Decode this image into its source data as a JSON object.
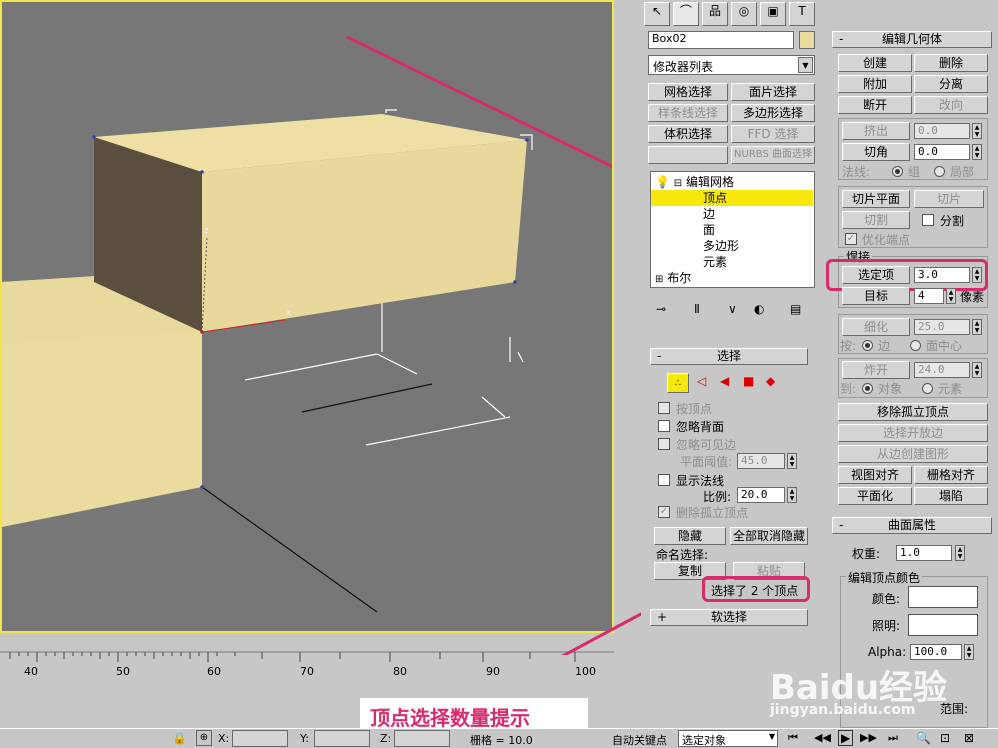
{
  "viewport": {
    "axis_x": "x",
    "axis_z": "z"
  },
  "ruler": {
    "ticks": [
      "40",
      "50",
      "60",
      "70",
      "80",
      "90",
      "100"
    ]
  },
  "caption": "顶点选择数量提示",
  "status": {
    "x_label": "X:",
    "y_label": "Y:",
    "z_label": "Z:",
    "grid": "栅格 = 10.0",
    "autokey": "自动关键点",
    "selection": "选定对象"
  },
  "modify_panel": {
    "object_name": "Box02",
    "modifier_list": "修改器列表",
    "buttons": [
      "网格选择",
      "面片选择",
      "样条线选择",
      "多边形选择",
      "体积选择",
      "FFD 选择",
      "NURBS 曲面选择"
    ],
    "stack": {
      "root": "编辑网格",
      "items": [
        "顶点",
        "边",
        "面",
        "多边形",
        "元素"
      ],
      "selected": "顶点",
      "bottom": "布尔"
    }
  },
  "selection": {
    "title": "选择",
    "by_vertex": "按顶点",
    "ignore_backfacing": "忽略背面",
    "ignore_visible_edges": "忽略可见边",
    "planar_thresh_label": "平面阈值:",
    "planar_thresh_value": "45.0",
    "show_normals": "显示法线",
    "scale_label": "比例:",
    "scale_value": "20.0",
    "delete_isolated": "删除孤立顶点",
    "hide": "隐藏",
    "unhide_all": "全部取消隐藏",
    "named_sel": "命名选择:",
    "copy": "复制",
    "paste": "粘贴",
    "info": "选择了 2 个顶点",
    "soft_selection": "软选择"
  },
  "edit_geometry": {
    "title": "编辑几何体",
    "create": "创建",
    "delete": "删除",
    "attach": "附加",
    "detach": "分离",
    "break": "断开",
    "turn": "改向",
    "extrude": "挤出",
    "extrude_value": "0.0",
    "chamfer": "切角",
    "chamfer_value": "0.0",
    "normal_label": "法线:",
    "group": "组",
    "local": "局部",
    "slice_plane": "切片平面",
    "slice": "切片",
    "cut": "切割",
    "split": "分割",
    "refine_ends": "优化端点",
    "weld": "焊接",
    "selected": "选定项",
    "selected_value": "3.0",
    "target": "目标",
    "target_value": "4",
    "pixels": "像素",
    "tessellate": "细化",
    "tess_value": "25.0",
    "by_label": "按:",
    "edge": "边",
    "face_center": "面中心",
    "explode": "炸开",
    "explode_value": "24.0",
    "to_label": "到:",
    "object": "对象",
    "element": "元素",
    "remove_isolated": "移除孤立顶点",
    "select_open_edges": "选择开放边",
    "create_shape": "从边创建图形",
    "view_align": "视图对齐",
    "grid_align": "栅格对齐",
    "planarize": "平面化",
    "collapse": "塌陷"
  },
  "surface": {
    "title": "曲面属性",
    "weight_label": "权重:",
    "weight_value": "1.0",
    "vertex_colors": "编辑顶点颜色",
    "color": "颜色:",
    "illum": "照明:",
    "alpha_label": "Alpha:",
    "alpha_value": "100.0",
    "range": "范围:"
  },
  "watermark": {
    "brand": "Baidu经验",
    "url": "jingyan.baidu.com"
  },
  "colors": {
    "viewport_bg": "#777777",
    "box": "#eadb9e",
    "box_dark": "#5a4f3e",
    "highlight": "#d82b6e",
    "selected_row": "#f5e80a"
  }
}
